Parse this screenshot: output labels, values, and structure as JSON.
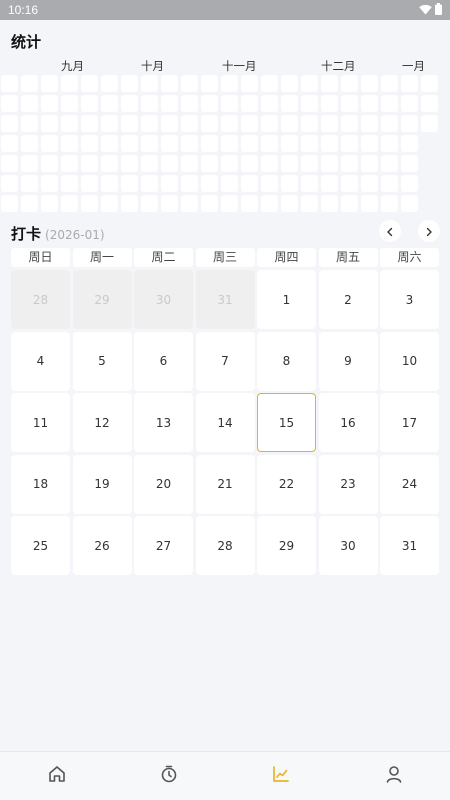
{
  "status_bar": {
    "time": "10:16"
  },
  "stats": {
    "title": "统计",
    "months": [
      "九月",
      "十月",
      "十一月",
      "十二月",
      "一月"
    ],
    "heatmap": {
      "weeks": 22,
      "rows": 7,
      "last_week_filled_days": 3
    }
  },
  "checkin": {
    "title": "打卡",
    "year_month": "(2026-01)",
    "weekdays": [
      "周日",
      "周一",
      "周二",
      "周三",
      "周四",
      "周五",
      "周六"
    ],
    "today": "15",
    "days": [
      {
        "label": "28",
        "in_month": false
      },
      {
        "label": "29",
        "in_month": false
      },
      {
        "label": "30",
        "in_month": false
      },
      {
        "label": "31",
        "in_month": false
      },
      {
        "label": "1",
        "in_month": true
      },
      {
        "label": "2",
        "in_month": true
      },
      {
        "label": "3",
        "in_month": true
      },
      {
        "label": "4",
        "in_month": true
      },
      {
        "label": "5",
        "in_month": true
      },
      {
        "label": "6",
        "in_month": true
      },
      {
        "label": "7",
        "in_month": true
      },
      {
        "label": "8",
        "in_month": true
      },
      {
        "label": "9",
        "in_month": true
      },
      {
        "label": "10",
        "in_month": true
      },
      {
        "label": "11",
        "in_month": true
      },
      {
        "label": "12",
        "in_month": true
      },
      {
        "label": "13",
        "in_month": true
      },
      {
        "label": "14",
        "in_month": true
      },
      {
        "label": "15",
        "in_month": true
      },
      {
        "label": "16",
        "in_month": true
      },
      {
        "label": "17",
        "in_month": true
      },
      {
        "label": "18",
        "in_month": true
      },
      {
        "label": "19",
        "in_month": true
      },
      {
        "label": "20",
        "in_month": true
      },
      {
        "label": "21",
        "in_month": true
      },
      {
        "label": "22",
        "in_month": true
      },
      {
        "label": "23",
        "in_month": true
      },
      {
        "label": "24",
        "in_month": true
      },
      {
        "label": "25",
        "in_month": true
      },
      {
        "label": "26",
        "in_month": true
      },
      {
        "label": "27",
        "in_month": true
      },
      {
        "label": "28",
        "in_month": true
      },
      {
        "label": "29",
        "in_month": true
      },
      {
        "label": "30",
        "in_month": true
      },
      {
        "label": "31",
        "in_month": true
      }
    ]
  },
  "bottom_nav": {
    "tabs": [
      {
        "icon": "home-icon",
        "active": false
      },
      {
        "icon": "timer-icon",
        "active": false
      },
      {
        "icon": "chart-icon",
        "active": true
      },
      {
        "icon": "user-icon",
        "active": false
      }
    ]
  },
  "colors": {
    "background": "#f3f5f9",
    "cell": "#ffffff",
    "outside_cell": "#efefef",
    "today_border": "#e2b32a",
    "active_tab": "#e8b52a",
    "inactive_tab": "#555555"
  }
}
